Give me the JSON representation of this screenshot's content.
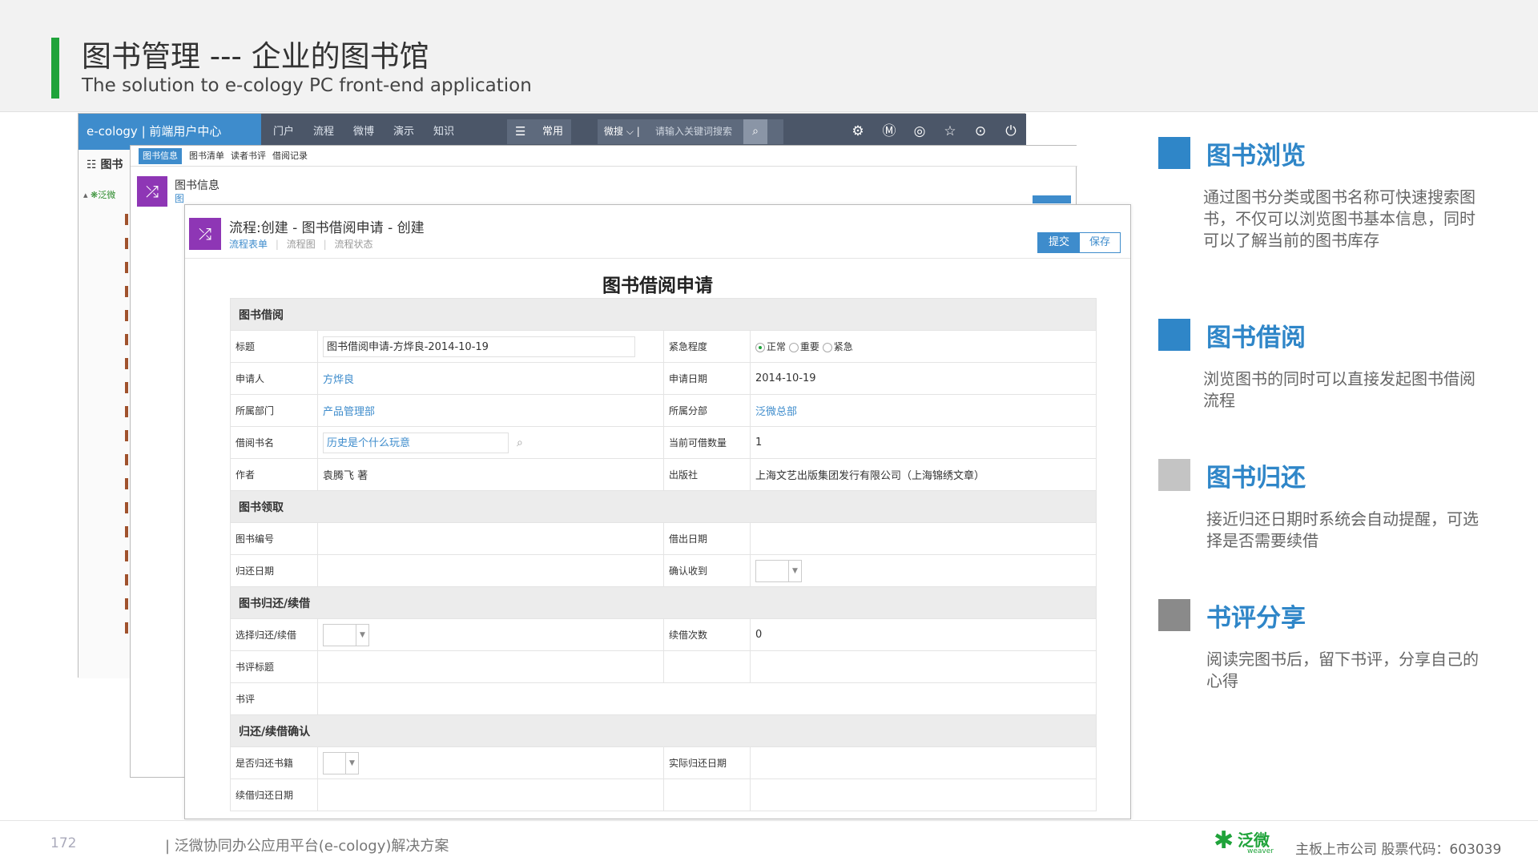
{
  "header": {
    "title": "图书管理 --- 企业的图书馆",
    "subtitle": "The solution to e-cology PC front-end application"
  },
  "app": {
    "logo": "e-cology | 前端用户中心",
    "nav": [
      "门户",
      "流程",
      "微博",
      "演示",
      "知识"
    ],
    "menu_button": "常用",
    "search_scope": "微搜",
    "search_placeholder": "请输入关键词搜索"
  },
  "left_panel": {
    "heading": "图书",
    "tree_item": "泛微"
  },
  "back_window": {
    "tabs": [
      "图书信息",
      "图书清单",
      "读者书评",
      "借阅记录"
    ],
    "title": "图书信息",
    "subtitle": "图"
  },
  "front_window": {
    "title": "流程:创建 - 图书借阅申请 - 创建",
    "subnav": [
      "流程表单",
      "流程图",
      "流程状态"
    ],
    "submit_label": "提交",
    "save_label": "保存",
    "form_title": "图书借阅申请"
  },
  "form": {
    "sections": [
      "图书借阅",
      "图书领取",
      "图书归还/续借",
      "归还/续借确认"
    ],
    "labels": {
      "title": "标题",
      "urgency": "紧急程度",
      "applicant": "申请人",
      "apply_date": "申请日期",
      "department": "所属部门",
      "branch": "所属分部",
      "book_name": "借阅书名",
      "available": "当前可借数量",
      "author": "作者",
      "publisher": "出版社",
      "book_no": "图书编号",
      "borrow_date": "借出日期",
      "return_date": "归还日期",
      "confirm_receive": "确认收到",
      "choose_return": "选择归还/续借",
      "renew_count": "续借次数",
      "review_title": "书评标题",
      "review": "书评",
      "is_returned": "是否归还书籍",
      "actual_return": "实际归还日期",
      "renew_return": "续借归还日期"
    },
    "values": {
      "title": "图书借阅申请-方烨良-2014-10-19",
      "urgency_options": [
        "正常",
        "重要",
        "紧急"
      ],
      "applicant": "方烨良",
      "apply_date": "2014-10-19",
      "department": "产品管理部",
      "branch": "泛微总部",
      "book_name": "历史是个什么玩意",
      "available": "1",
      "author": "袁腾飞 著",
      "publisher": "上海文艺出版集团发行有限公司（上海锦绣文章）",
      "renew_count": "0"
    }
  },
  "features": [
    {
      "title": "图书浏览",
      "desc": "通过图书分类或图书名称可快速搜索图书，不仅可以浏览图书基本信息，同时可以了解当前的图书库存",
      "color": "#2f86c8"
    },
    {
      "title": "图书借阅",
      "desc": "浏览图书的同时可以直接发起图书借阅流程",
      "color": "#2f86c8"
    },
    {
      "title": "图书归还",
      "desc": "接近归还日期时系统会自动提醒，可选择是否需要续借",
      "color": "#c4c4c4"
    },
    {
      "title": "书评分享",
      "desc": "阅读完图书后，留下书评，分享自己的心得",
      "color": "#8a8a8a"
    }
  ],
  "feature_title_color": "#2f86c8",
  "footer": {
    "page": "172",
    "text": "| 泛微协同办公应用平台(e-cology)解决方案",
    "brand": "泛微",
    "brand_sub": "weaver",
    "right": "主板上市公司   股票代码：603039"
  }
}
